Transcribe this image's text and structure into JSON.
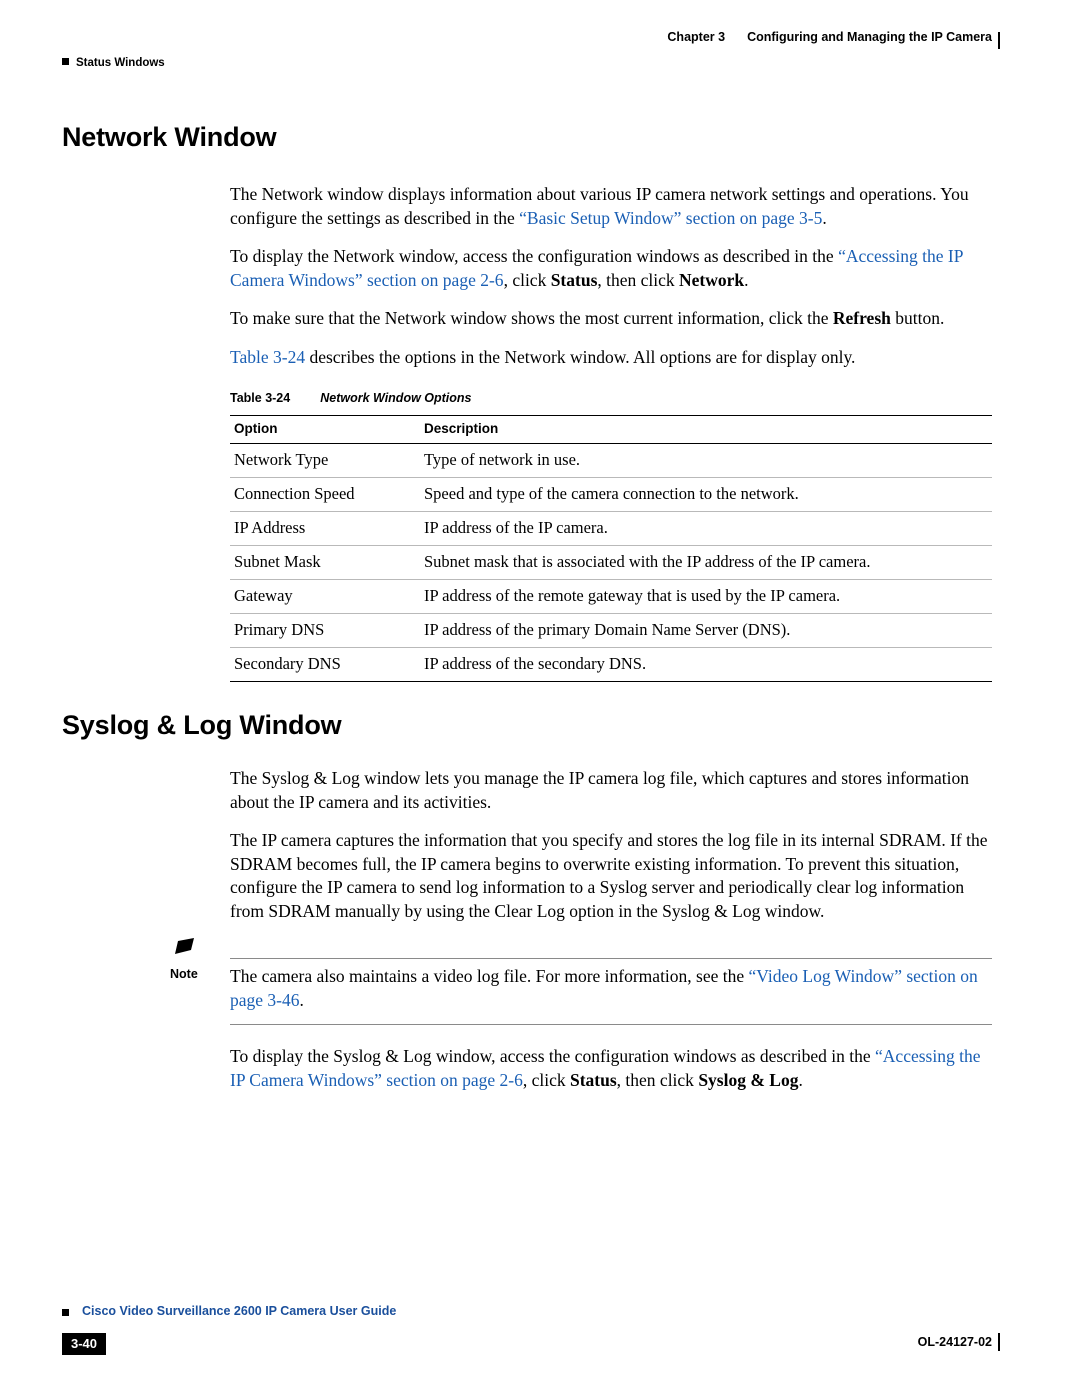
{
  "header": {
    "chapter_num": "Chapter 3",
    "chapter_title": "Configuring and Managing the IP Camera",
    "running_head": "Status Windows"
  },
  "sections": [
    {
      "title": "Network Window",
      "paragraphs": [
        "The Network window displays information about various IP camera network settings and operations. You configure the settings as described in the “Basic Setup Window” section on page 3-5.",
        "To display the Network window, access the configuration windows as described in the “Accessing the IP Camera Windows” section on page 2-6, click Status, then click Network.",
        "To make sure that the Network window shows the most current information, click the Refresh button.",
        "Table 3-24 describes the options in the Network window. All options are for display only."
      ]
    },
    {
      "title": "Syslog & Log Window",
      "paragraphs": [
        "The Syslog & Log window lets you manage the IP camera log file, which captures and stores information about the IP camera and its activities.",
        "The IP camera captures the information that you specify and stores the log file in its internal SDRAM. If the SDRAM becomes full, the IP camera begins to overwrite existing information. To prevent this situation, configure the IP camera to send log information to a Syslog server and periodically clear log information from SDRAM manually by using the Clear Log option in the Syslog & Log window."
      ]
    }
  ],
  "table": {
    "caption_number": "Table 3-24",
    "caption_title": "Network Window Options",
    "headers": [
      "Option",
      "Description"
    ],
    "rows": [
      [
        "Network Type",
        "Type of network in use."
      ],
      [
        "Connection Speed",
        "Speed and type of the camera connection to the network."
      ],
      [
        "IP Address",
        "IP address of the IP camera."
      ],
      [
        "Subnet Mask",
        "Subnet mask that is associated with the IP address of the IP camera."
      ],
      [
        "Gateway",
        "IP address of the remote gateway that is used by the IP camera."
      ],
      [
        "Primary DNS",
        "IP address of the primary Domain Name Server (DNS)."
      ],
      [
        "Secondary DNS",
        "IP address of the secondary DNS."
      ]
    ]
  },
  "note": {
    "label": "Note",
    "text": "The camera also maintains a video log file. For more information, see the “Video Log Window” section on page 3-46."
  },
  "closing_paragraph": "To display the Syslog & Log window, access the configuration windows as described in the “Accessing the IP Camera Windows” section on page 2-6, click Status, then click Syslog & Log.",
  "footer": {
    "guide_title": "Cisco Video Surveillance 2600 IP Camera User Guide",
    "page_number": "3-40",
    "doc_number": "OL-24127-02"
  }
}
